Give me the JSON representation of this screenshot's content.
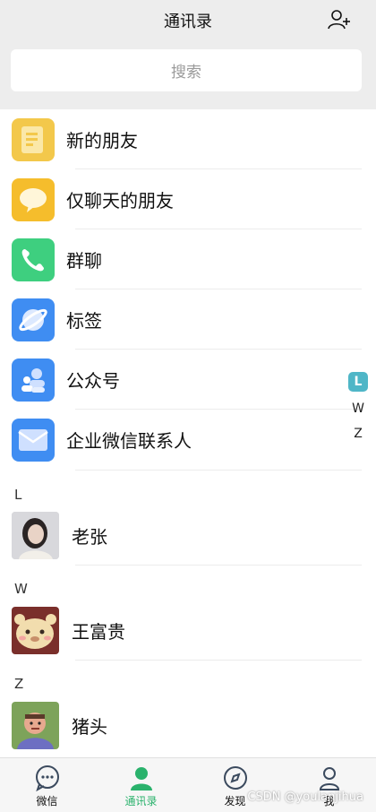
{
  "header": {
    "title": "通讯录",
    "add_icon": "add-friend-icon"
  },
  "search": {
    "placeholder": "搜索"
  },
  "features": [
    {
      "label": "新的朋友",
      "icon": "new-friends-icon",
      "color": "#f3c84b"
    },
    {
      "label": "仅聊天的朋友",
      "icon": "chat-only-friends-icon",
      "color": "#f5bd2c"
    },
    {
      "label": "群聊",
      "icon": "group-chat-icon",
      "color": "#3ecf7f"
    },
    {
      "label": "标签",
      "icon": "tag-icon",
      "color": "#3f8df2"
    },
    {
      "label": "公众号",
      "icon": "official-accounts-icon",
      "color": "#3f8df2"
    },
    {
      "label": "企业微信联系人",
      "icon": "enterprise-contacts-icon",
      "color": "#3f8df2"
    }
  ],
  "sections": [
    {
      "letter": "L",
      "contacts": [
        {
          "name": "老张"
        }
      ]
    },
    {
      "letter": "W",
      "contacts": [
        {
          "name": "王富贵"
        }
      ]
    },
    {
      "letter": "Z",
      "contacts": [
        {
          "name": "猪头"
        }
      ]
    }
  ],
  "index_bar": {
    "letters": [
      "L",
      "W",
      "Z"
    ],
    "active": "L"
  },
  "tabbar": {
    "tabs": [
      {
        "label": "微信",
        "icon": "chat-bubble-icon"
      },
      {
        "label": "通讯录",
        "icon": "contacts-icon"
      },
      {
        "label": "发现",
        "icon": "compass-icon"
      },
      {
        "label": "我",
        "icon": "me-icon"
      }
    ],
    "active": "通讯录",
    "accent": "#2ab26c"
  },
  "watermark": "CSDN @youlanjihua"
}
